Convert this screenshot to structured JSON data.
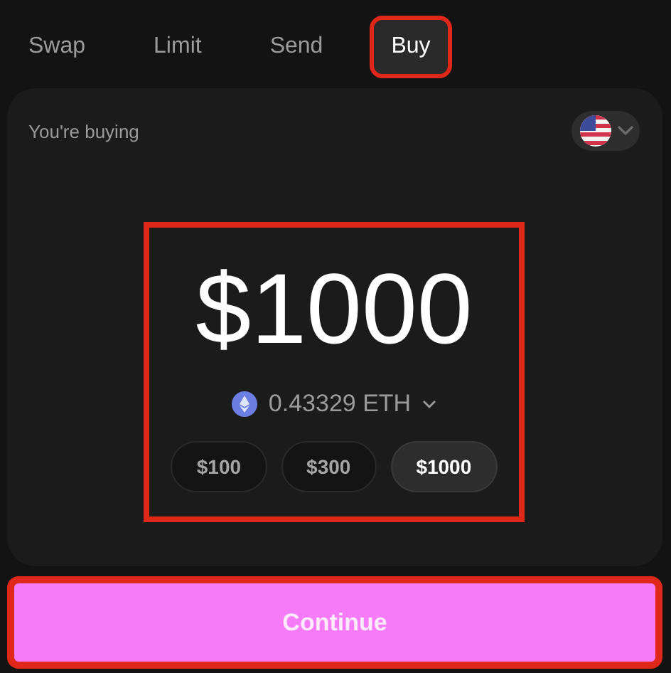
{
  "tabs": [
    {
      "label": "Swap",
      "selected": false,
      "highlighted": false
    },
    {
      "label": "Limit",
      "selected": false,
      "highlighted": false
    },
    {
      "label": "Send",
      "selected": false,
      "highlighted": false
    },
    {
      "label": "Buy",
      "selected": true,
      "highlighted": true
    }
  ],
  "card": {
    "label": "You're buying",
    "amount": "$1000",
    "highlighted": true,
    "token_amount": "0.43329 ETH",
    "presets": [
      {
        "label": "$100",
        "selected": false
      },
      {
        "label": "$300",
        "selected": false
      },
      {
        "label": "$1000",
        "selected": true
      }
    ]
  },
  "continue_button": {
    "label": "Continue",
    "highlighted": true
  }
}
